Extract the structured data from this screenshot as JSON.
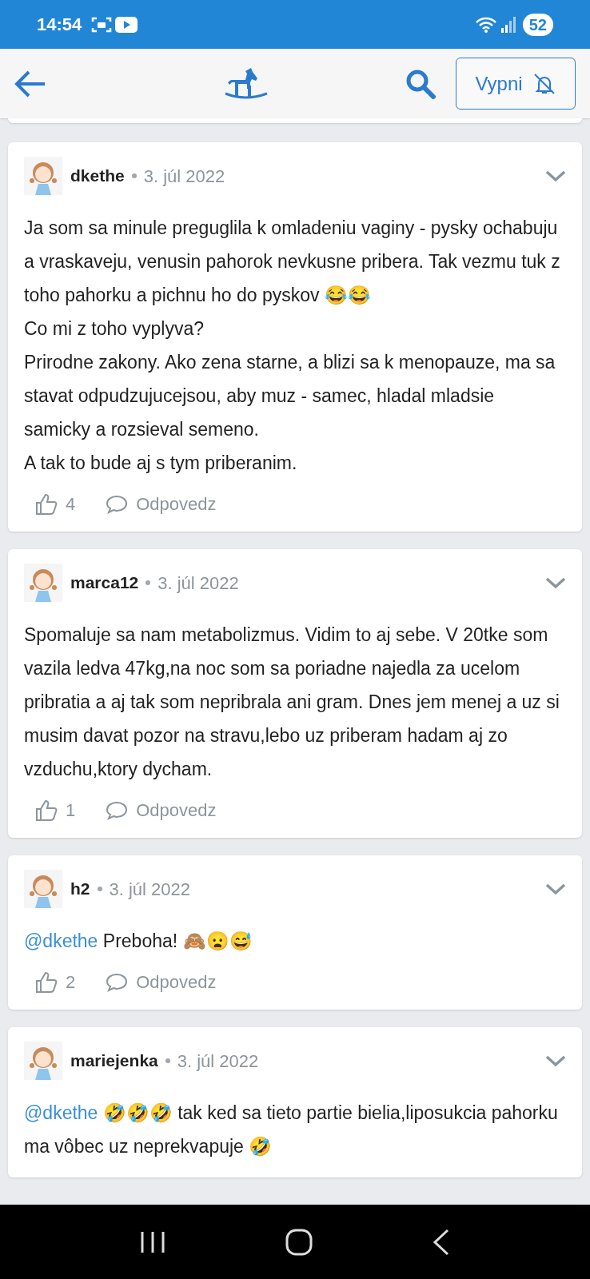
{
  "status_bar": {
    "time": "14:54",
    "battery": "52"
  },
  "header": {
    "mute_button": "Vypni"
  },
  "posts": [
    {
      "author": "dkethe",
      "date": "3. júl 2022",
      "paragraphs": [
        {
          "text": "Ja som sa minule preguglila k omladeniu vaginy - pysky ochabuju a vraskaveju, venusin pahorok nevkusne pribera. Tak vezmu tuk z toho pahorku a pichnu ho do pyskov 😂😂"
        },
        {
          "text": "Co mi z toho vyplyva?"
        },
        {
          "text": "Prirodne zakony. Ako zena starne, a blizi sa k menopauze, ma sa stavat odpudzujucejsou, aby muz - samec, hladal mladsie samicky a rozsieval semeno."
        },
        {
          "text": "A tak to bude aj s tym priberanim."
        }
      ],
      "likes": "4",
      "reply": "Odpovedz"
    },
    {
      "author": "marca12",
      "date": "3. júl 2022",
      "paragraphs": [
        {
          "text": "Spomaluje sa nam metabolizmus. Vidim to aj sebe. V 20tke som vazila ledva 47kg,na noc som sa poriadne najedla za ucelom pribratia a aj tak som nepribrala ani gram. Dnes jem menej a uz si musim davat pozor na stravu,lebo uz priberam hadam aj zo vzduchu,ktory dycham."
        }
      ],
      "likes": "1",
      "reply": "Odpovedz"
    },
    {
      "author": "h2",
      "date": "3. júl 2022",
      "paragraphs": [
        {
          "mention": "@dkethe",
          "text": "Preboha! 🙈😦😅"
        }
      ],
      "likes": "2",
      "reply": "Odpovedz"
    },
    {
      "author": "mariejenka",
      "date": "3. júl 2022",
      "paragraphs": [
        {
          "mention": "@dkethe",
          "text": "🤣🤣🤣 tak ked sa tieto partie bielia,liposukcia pahorku ma vôbec uz neprekvapuje 🤣"
        }
      ]
    }
  ]
}
